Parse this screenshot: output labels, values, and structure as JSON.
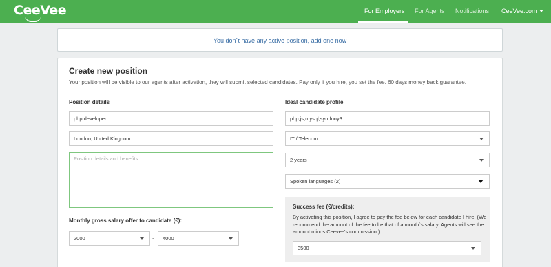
{
  "brand": {
    "logo": "CeeVee"
  },
  "nav": {
    "items": [
      {
        "label": "For Employers",
        "active": true
      },
      {
        "label": "For Agents",
        "active": false
      },
      {
        "label": "Notifications",
        "active": false
      },
      {
        "label": "CeeVee.com",
        "active": false
      }
    ]
  },
  "notice": {
    "text": "You don`t have any active position, add one now"
  },
  "form": {
    "title": "Create new position",
    "subtitle": "Your position will be visible to our agents after activation, they will submit selected candidates. Pay only if you hire, you set the fee. 60 days money back guarantee.",
    "position_details": {
      "label": "Position details",
      "title_value": "php developer",
      "location_value": "London, United Kingdom",
      "description_placeholder": "Position details and benefits"
    },
    "salary": {
      "label": "Monthly gross salary offer to candidate (€):",
      "from_value": "2000",
      "separator": "-",
      "to_value": "4000"
    },
    "ideal_profile": {
      "label": "Ideal candidate profile",
      "skills_value": "php,js,mysql,symfony3",
      "industry_value": "IT / Telecom",
      "experience_value": "2 years",
      "languages_value": "Spoken languages (2)"
    },
    "fee": {
      "title": "Success fee (€/credits):",
      "description": "By activating this position, I agree to pay the fee below for each candidate I hire. (We recommend the amount of the fee to be that of a month`s salary. Agents will see the amount minus Ceevee's commission.)",
      "value": "3500"
    }
  },
  "colors": {
    "brand_green": "#4caf50",
    "link_blue": "#3a6ea5",
    "focus_green": "#7fc77f"
  }
}
